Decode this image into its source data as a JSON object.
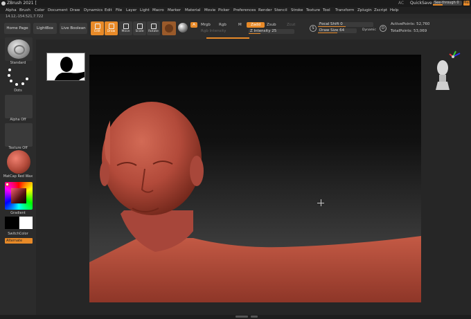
{
  "app": {
    "title": "ZBrush 2021 [",
    "ac_label": "AC",
    "quicksave": "QuickSave",
    "see_through": "See-through 0",
    "see_through_value": 0,
    "menus_label": "Menus"
  },
  "menu": [
    "Alpha",
    "Brush",
    "Color",
    "Document",
    "Draw",
    "Dynamics",
    "Edit",
    "File",
    "Layer",
    "Light",
    "Macro",
    "Marker",
    "Material",
    "Movie",
    "Picker",
    "Preferences",
    "Render",
    "Stencil",
    "Stroke",
    "Texture",
    "Tool",
    "Transform",
    "Zplugin",
    "Zscript",
    "Help"
  ],
  "coords": "14.12,-154.521,7.722",
  "shelf": {
    "home": "Home Page",
    "lightbox": "LightBox",
    "live_boolean": "Live Boolean",
    "edit": "Edit",
    "draw": "Draw",
    "move": "Move",
    "scale": "Scale",
    "rotate": "Rotate",
    "a_btn": "A",
    "mrgb": "Mrgb",
    "rgb": "Rgb",
    "m": "M",
    "zadd": "Zadd",
    "zsub": "Zsub",
    "zcut": "Zcut",
    "rgb_intensity": "Rgb Intensity",
    "z_intensity": "Z Intensity 25",
    "z_intensity_value": 25,
    "focal_shift": "Focal Shift 0",
    "focal_shift_value": 0,
    "draw_size": "Draw Size 64",
    "draw_size_value": 64,
    "dynamic": "Dynamic",
    "dial_s": "S",
    "dial_d": "D",
    "active_points": "ActivePoints: 52,760",
    "total_points": "TotalPoints: 53,069"
  },
  "left": {
    "brush": "Standard",
    "stroke": "Dots",
    "alpha": "Alpha Off",
    "texture": "Texture Off",
    "material": "MatCap Red Wax",
    "gradient": "Gradient",
    "switch_color": "SwitchColor",
    "alternate": "Alternate"
  },
  "colors": {
    "accent": "#e88a28",
    "ui_bg": "#2a2a2a",
    "wax": "#b24a3a"
  }
}
